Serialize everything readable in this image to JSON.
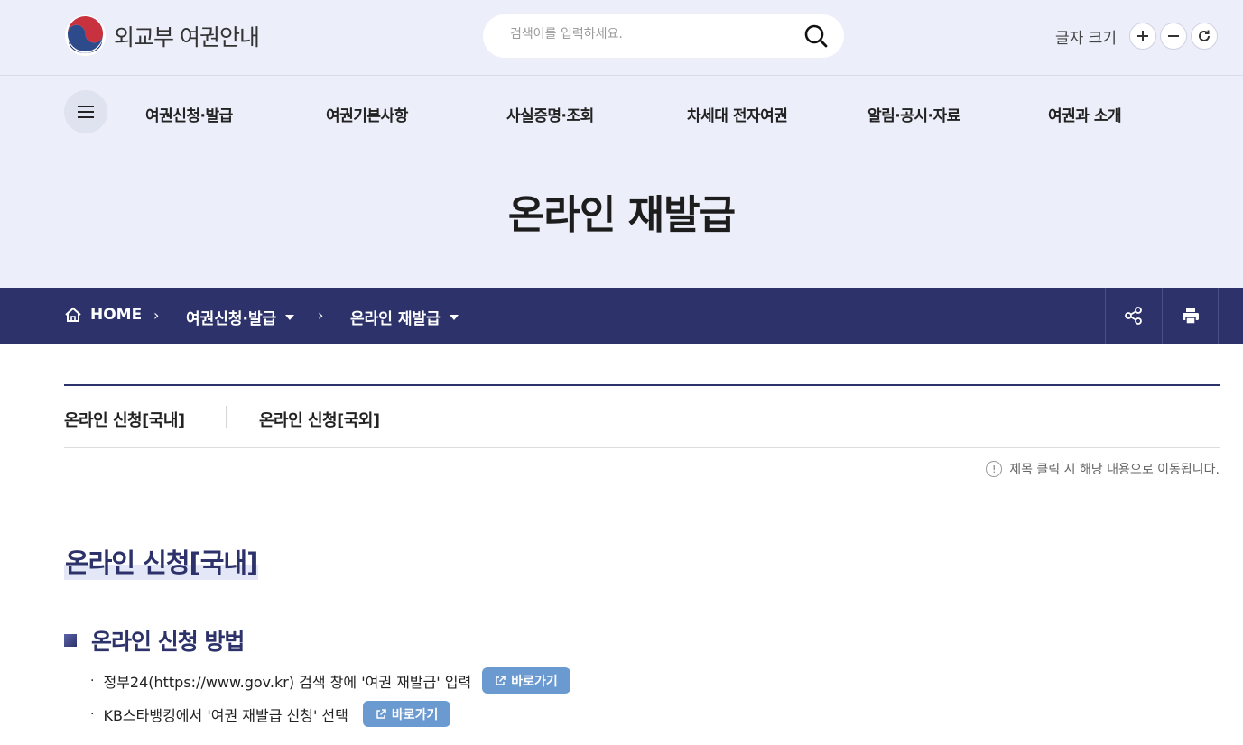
{
  "header": {
    "site_title": "외교부 여권안내",
    "search_placeholder": "검색어를 입력하세요.",
    "font_size_label": "글자 크기"
  },
  "gnb": {
    "items": [
      {
        "label": "여권신청·발급"
      },
      {
        "label": "여권기본사항"
      },
      {
        "label": "사실증명·조회"
      },
      {
        "label": "차세대 전자여권"
      },
      {
        "label": "알림·공시·자료"
      },
      {
        "label": "여권과 소개"
      }
    ]
  },
  "page": {
    "title": "온라인 재발급"
  },
  "breadcrumb": {
    "home": "HOME",
    "level1": "여권신청·발급",
    "level2": "온라인 재발급"
  },
  "tabs": [
    {
      "label": "온라인 신청[국내]"
    },
    {
      "label": "온라인 신청[국외]"
    }
  ],
  "notice": {
    "text": "제목 클릭 시 해당 내용으로 이동됩니다.",
    "icon_glyph": "!"
  },
  "content": {
    "section_title": "온라인 신청[국내]",
    "sub_title": "온라인 신청 방법",
    "items": [
      {
        "text": "정부24(https://www.gov.kr) 검색 창에 '여권 재발급' 입력",
        "button": "바로가기"
      },
      {
        "text": "KB스타뱅킹에서 '여권 재발급 신청' 선택",
        "button": "바로가기"
      }
    ]
  },
  "colors": {
    "navy": "#2d336a",
    "hero_bg": "#eceef9",
    "button_blue": "#6b9ad1"
  }
}
